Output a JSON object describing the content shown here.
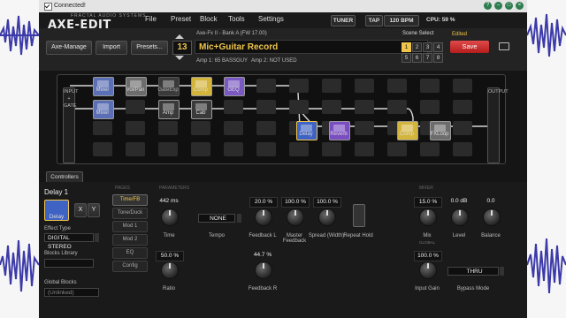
{
  "window": {
    "title": "Connected!",
    "button_labels": [
      "?",
      "–",
      "□",
      "×"
    ]
  },
  "brand": {
    "small": "FRACTAL AUDIO SYSTEMS",
    "name": "AXE-EDIT"
  },
  "menu": [
    "File",
    "Preset",
    "Block",
    "Tools",
    "Settings"
  ],
  "status": {
    "tuner": "TUNER",
    "tap": "TAP",
    "bpm": "120 BPM",
    "cpu": "CPU: 59 %"
  },
  "toolbar": {
    "axe_manage": "Axe-Manage",
    "import": "Import",
    "presets": "Presets...",
    "device_info": "Axe-Fx II - Bank A (FW 17.00)",
    "preset_number": "13",
    "preset_name": "Mic+Guitar Record",
    "amp1": "Amp 1: 65 BASSGUY",
    "amp2": "Amp 2: NOT USED",
    "scene_select": "Scene Select",
    "edited": "Edited",
    "scenes": [
      "1",
      "2",
      "3",
      "4",
      "5",
      "6",
      "7",
      "8"
    ],
    "active_scene": "1",
    "save": "Save"
  },
  "grid": {
    "input_label": "INPUT + GATE",
    "output_label": "OUTPUT",
    "blocks": [
      {
        "label": "Mixer",
        "color": "#5b6fb6"
      },
      {
        "label": "Vol/Pan",
        "color": "#6c6c6c"
      },
      {
        "label": "GateExp",
        "color": "#3a3a3a"
      },
      {
        "label": "Comp",
        "color": "#d4b53b"
      },
      {
        "label": "GEQ",
        "color": "#7a59c2"
      },
      {
        "label": "Mixer",
        "color": "#5b6fb6"
      },
      {
        "label": "Amp",
        "color": "#3a3a3a"
      },
      {
        "label": "Cab",
        "color": "#3a3a3a"
      },
      {
        "label": "Delay",
        "color": "#3f63c4"
      },
      {
        "label": "Reverb",
        "color": "#7a4dc0"
      },
      {
        "label": "Comp",
        "color": "#d4b53b"
      },
      {
        "label": "FXLoop",
        "color": "#6c6c6c"
      }
    ]
  },
  "controllers": "Controllers",
  "editor": {
    "block_title": "Delay 1",
    "block_button": "Delay",
    "x": "X",
    "y": "Y",
    "effect_type_label": "Effect Type",
    "effect_type": "DIGITAL STEREO",
    "blocks_library": "Blocks Library",
    "global_blocks": "Global Blocks",
    "global_value": "(Unlinked)",
    "pages_label": "PAGES",
    "parameters_label": "PARAMETERS",
    "mixer_label": "MIXER",
    "pages": [
      "Time/FB",
      "Tone/Duck",
      "Mod 1",
      "Mod 2",
      "EQ",
      "Config"
    ],
    "active_page": "Time/FB",
    "params": {
      "time": {
        "value": "442 ms",
        "label": "Time"
      },
      "tempo": {
        "value": "NONE",
        "label": "Tempo"
      },
      "feedback_l": {
        "value": "20.0 %",
        "label": "Feedback L"
      },
      "master_feedback": {
        "value": "100.0 %",
        "label": "Master Feedback"
      },
      "spread": {
        "value": "100.0 %",
        "label": "Spread (Width)"
      },
      "repeat_hold": {
        "label": "Repeat Hold"
      },
      "ratio": {
        "value": "50.0 %",
        "label": "Ratio"
      },
      "feedback_r": {
        "value": "44.7 %",
        "label": "Feedback R"
      }
    },
    "mixer": {
      "mix": {
        "value": "15.0 %",
        "label": "Mix",
        "badge": "GLOBAL"
      },
      "level": {
        "value": "0.0 dB",
        "label": "Level"
      },
      "balance": {
        "value": "0.0",
        "label": "Balance"
      },
      "input_gain": {
        "value": "100.0 %",
        "label": "Input Gain"
      },
      "bypass_mode": {
        "value": "THRU",
        "label": "Bypass Mode"
      }
    }
  }
}
